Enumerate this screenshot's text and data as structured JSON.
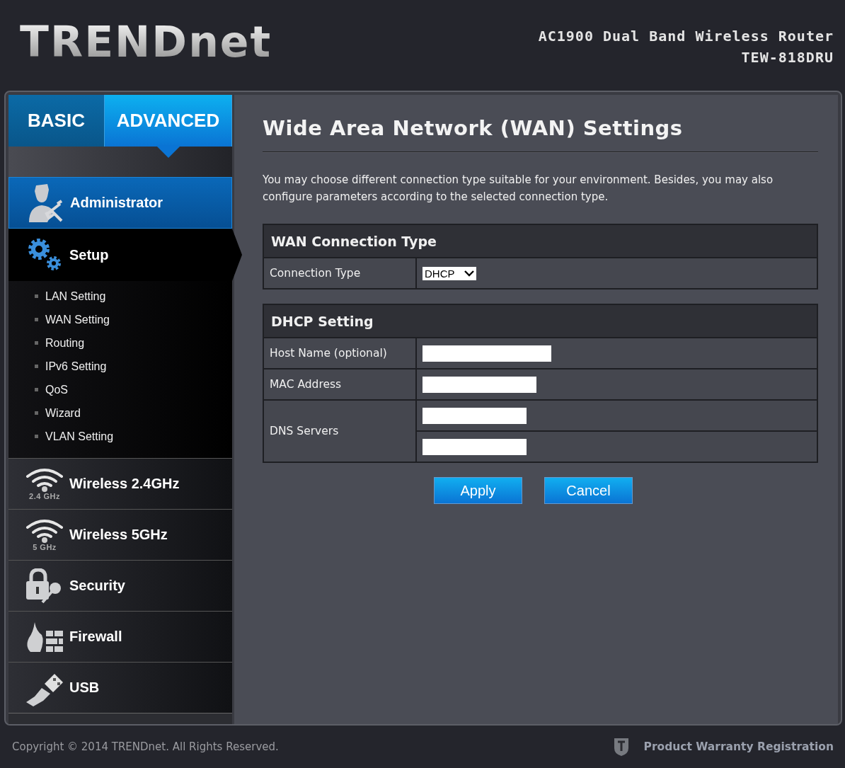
{
  "header": {
    "logo": "TRENDnet",
    "product": "AC1900 Dual Band Wireless Router",
    "model": "TEW-818DRU"
  },
  "tabs": [
    {
      "label": "BASIC",
      "selected": false
    },
    {
      "label": "ADVANCED",
      "selected": true
    }
  ],
  "menu": [
    {
      "label": "Administrator",
      "kind": "admin",
      "highlighted": true,
      "selected": false
    },
    {
      "label": "Setup",
      "kind": "setup",
      "highlighted": false,
      "selected": true,
      "expanded": true,
      "children": [
        {
          "label": "LAN Setting"
        },
        {
          "label": "WAN Setting"
        },
        {
          "label": "Routing"
        },
        {
          "label": "IPv6 Setting"
        },
        {
          "label": "QoS"
        },
        {
          "label": "Wizard"
        },
        {
          "label": "VLAN Setting"
        }
      ]
    },
    {
      "label": "Wireless 2.4GHz",
      "kind": "wifi",
      "icon_label": "2.4 GHz",
      "highlighted": false,
      "selected": false
    },
    {
      "label": "Wireless 5GHz",
      "kind": "wifi",
      "icon_label": "5 GHz",
      "highlighted": false,
      "selected": false
    },
    {
      "label": "Security",
      "kind": "security",
      "highlighted": false,
      "selected": false
    },
    {
      "label": "Firewall",
      "kind": "firewall",
      "highlighted": false,
      "selected": false
    },
    {
      "label": "USB",
      "kind": "usb",
      "highlighted": false,
      "selected": false
    }
  ],
  "page": {
    "title": "Wide Area Network (WAN) Settings",
    "intro": "You may choose different connection type suitable for your environment. Besides, you may also configure parameters according to the selected connection type.",
    "sections": [
      {
        "heading": "WAN Connection Type",
        "rows": [
          {
            "label": "Connection Type",
            "kind": "select",
            "value": "DHCP"
          }
        ]
      },
      {
        "heading": "DHCP Setting",
        "rows": [
          {
            "label": "Host Name (optional)",
            "kind": "input"
          },
          {
            "label": "MAC Address",
            "kind": "input"
          },
          {
            "label": "DNS Servers",
            "kind": "input-pair"
          }
        ]
      }
    ],
    "buttons": [
      "Apply",
      "Cancel"
    ]
  },
  "footer": {
    "copyright": "Copyright © 2014 TRENDnet. All Rights Reserved.",
    "link": "Product Warranty Registration"
  }
}
